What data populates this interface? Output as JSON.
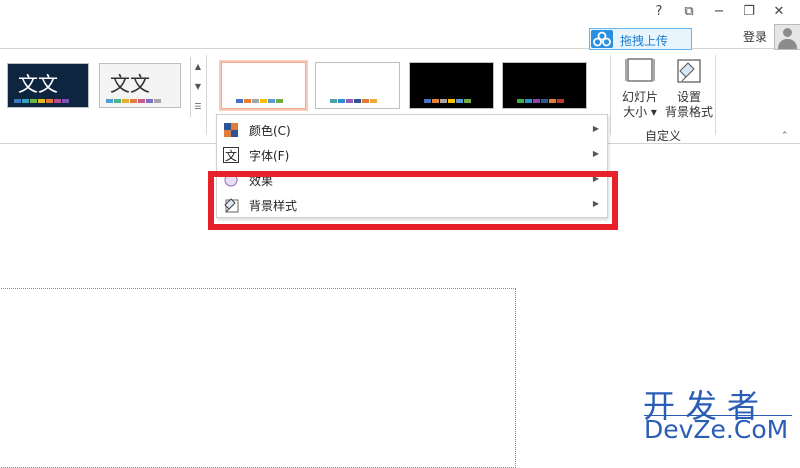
{
  "window": {
    "controls": [
      "?",
      "⧉",
      "🗕",
      "🗗",
      "✕"
    ],
    "login_label": "登录",
    "upload_button": "拖拽上传"
  },
  "themes": [
    {
      "glyph": "文文",
      "bg": "#0e2540",
      "text_color": "#ffffff",
      "bars": [
        "#3b78c2",
        "#30a1c2",
        "#6bb944",
        "#e7b622",
        "#e37a2b",
        "#b64c8e",
        "#7a4fb7"
      ]
    },
    {
      "glyph": "文文",
      "bg": "#f4f4f4",
      "text_color": "#333333",
      "bars": [
        "#4aa3d6",
        "#4cb38e",
        "#e2b32a",
        "#e27d3e",
        "#c75d8a",
        "#7b6fc4",
        "#a6a6a6"
      ]
    }
  ],
  "variants": [
    {
      "bg": "#ffffff",
      "selected": true,
      "bars": [
        "#4472c4",
        "#ed7d31",
        "#a5a5a5",
        "#ffc000",
        "#5b9bd5",
        "#70ad47"
      ]
    },
    {
      "bg": "#ffffff",
      "selected": false,
      "bars": [
        "#4aa3a3",
        "#2b8fd0",
        "#9b59b6",
        "#2f5597",
        "#e07b39",
        "#f2a93b"
      ]
    },
    {
      "bg": "#000000",
      "selected": false,
      "bars": [
        "#4472c4",
        "#ed7d31",
        "#a5a5a5",
        "#ffc000",
        "#5b9bd5",
        "#70ad47"
      ]
    },
    {
      "bg": "#000000",
      "selected": false,
      "bars": [
        "#3fae49",
        "#2b8fd0",
        "#8e44ad",
        "#2f5597",
        "#e07b39",
        "#c0392b"
      ]
    }
  ],
  "customize": {
    "slide_size_label": "幻灯片",
    "slide_size_sub": "大小",
    "format_bg_label": "设置",
    "format_bg_sub": "背景格式",
    "group_label": "自定义"
  },
  "menu": {
    "items": [
      {
        "label": "颜色(C)",
        "icon": "color-palette-icon"
      },
      {
        "label": "字体(F)",
        "icon": "font-icon"
      },
      {
        "label": "效果",
        "icon": "effects-icon"
      },
      {
        "label": "背景样式",
        "icon": "background-style-icon"
      }
    ]
  },
  "highlight_color": "#e8202a",
  "watermark": {
    "cn": "开发者",
    "en": "DevZe.CoM"
  }
}
